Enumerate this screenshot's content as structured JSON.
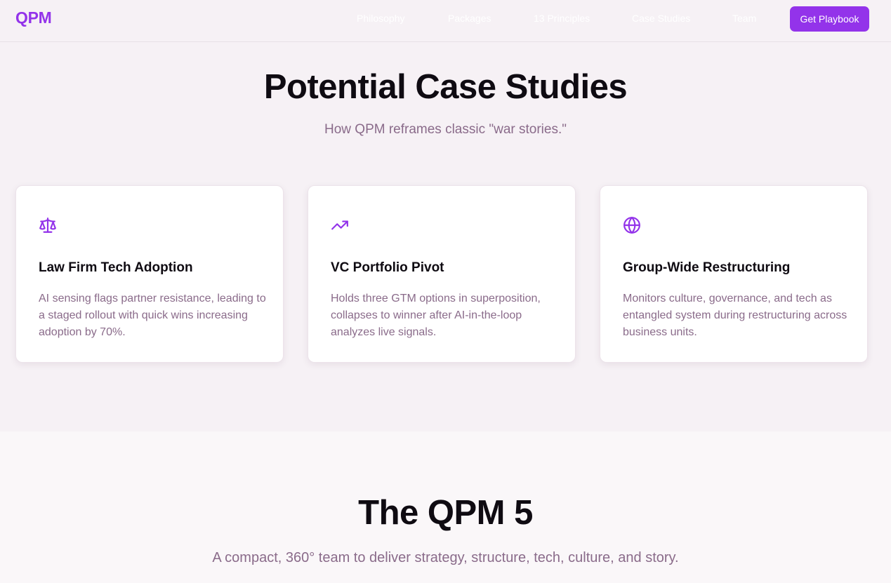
{
  "header": {
    "logo": "QPM",
    "nav": [
      "Philosophy",
      "Packages",
      "13 Principles",
      "Case Studies",
      "Team"
    ],
    "cta": "Get Playbook"
  },
  "case_studies": {
    "title": "Potential Case Studies",
    "subtitle": "How QPM reframes classic \"war stories.\"",
    "cards": [
      {
        "icon": "scale-icon",
        "title": "Law Firm Tech Adoption",
        "text": "AI sensing flags partner resistance, leading to a staged rollout with quick wins increasing adoption by 70%."
      },
      {
        "icon": "trending-up-icon",
        "title": "VC Portfolio Pivot",
        "text": "Holds three GTM options in superposition, collapses to winner after AI-in-the-loop analyzes live signals."
      },
      {
        "icon": "globe-icon",
        "title": "Group-Wide Restructuring",
        "text": "Monitors culture, governance, and tech as entangled system during restructuring across business units."
      }
    ]
  },
  "qpm5": {
    "title": "The QPM 5",
    "subtitle": "A compact, 360° team to deliver strategy, structure, tech, culture, and story."
  },
  "colors": {
    "accent": "#9333ea",
    "muted_text": "#8a6b8a",
    "heading_text": "#0f0b12",
    "page_bg": "#f6f1f5"
  }
}
